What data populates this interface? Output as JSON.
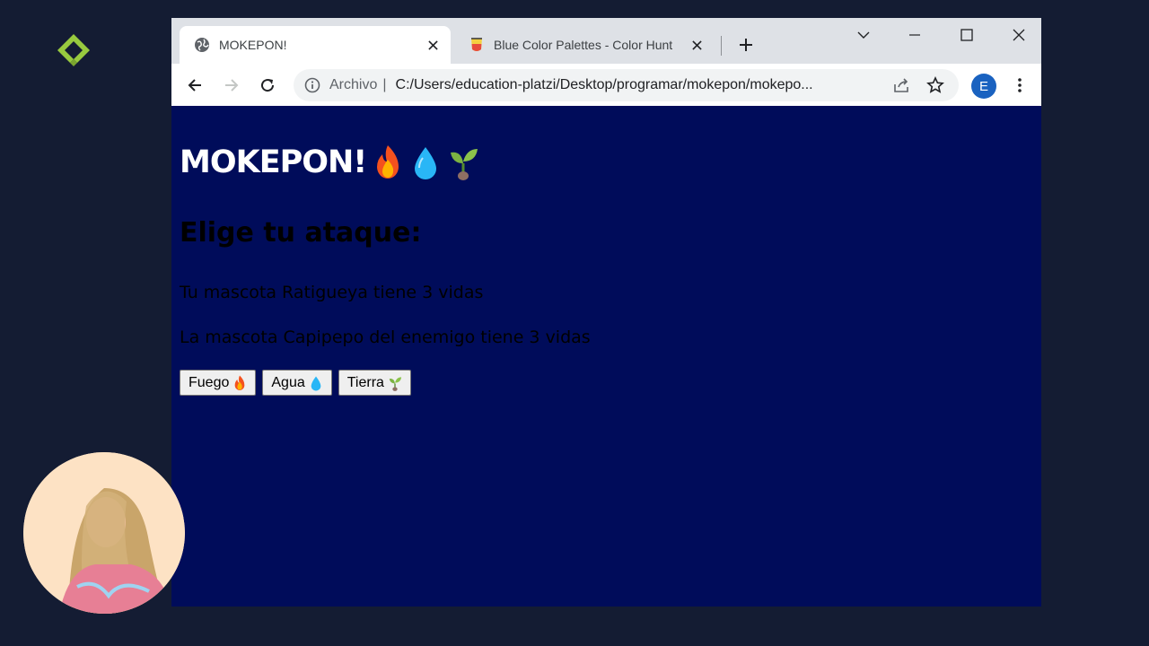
{
  "brand": {
    "logo_icon": "platzi-logo-icon",
    "color": "#98ca3f"
  },
  "browser": {
    "tabs": [
      {
        "title": "MOKEPON!",
        "favicon": "globe-icon",
        "active": true
      },
      {
        "title": "Blue Color Palettes - Color Hunt",
        "favicon": "color-hunt-icon",
        "active": false
      }
    ],
    "address": {
      "security_label": "Archivo",
      "separator": "|",
      "url": "C:/Users/education-platzi/Desktop/programar/mokepon/mokepo..."
    },
    "profile_initial": "E",
    "colors": {
      "tabstrip": "#dee1e6",
      "toolbar": "#ffffff",
      "avatar": "#1a62c0"
    }
  },
  "page": {
    "background": "#000c5a",
    "title": "MOKEPON!",
    "title_emojis": [
      "fire-emoji-icon",
      "droplet-emoji-icon",
      "seedling-emoji-icon"
    ],
    "attack_heading": "Elige tu ataque:",
    "player_lives": "Tu mascota Ratigueya tiene 3 vidas",
    "enemy_lives": "La mascota Capipepo del enemigo tiene 3 vidas",
    "buttons": [
      {
        "label": "Fuego",
        "icon": "fire-emoji-icon"
      },
      {
        "label": "Agua",
        "icon": "droplet-emoji-icon"
      },
      {
        "label": "Tierra",
        "icon": "seedling-emoji-icon"
      }
    ]
  },
  "presenter": {
    "description_icon": "presenter-webcam"
  }
}
